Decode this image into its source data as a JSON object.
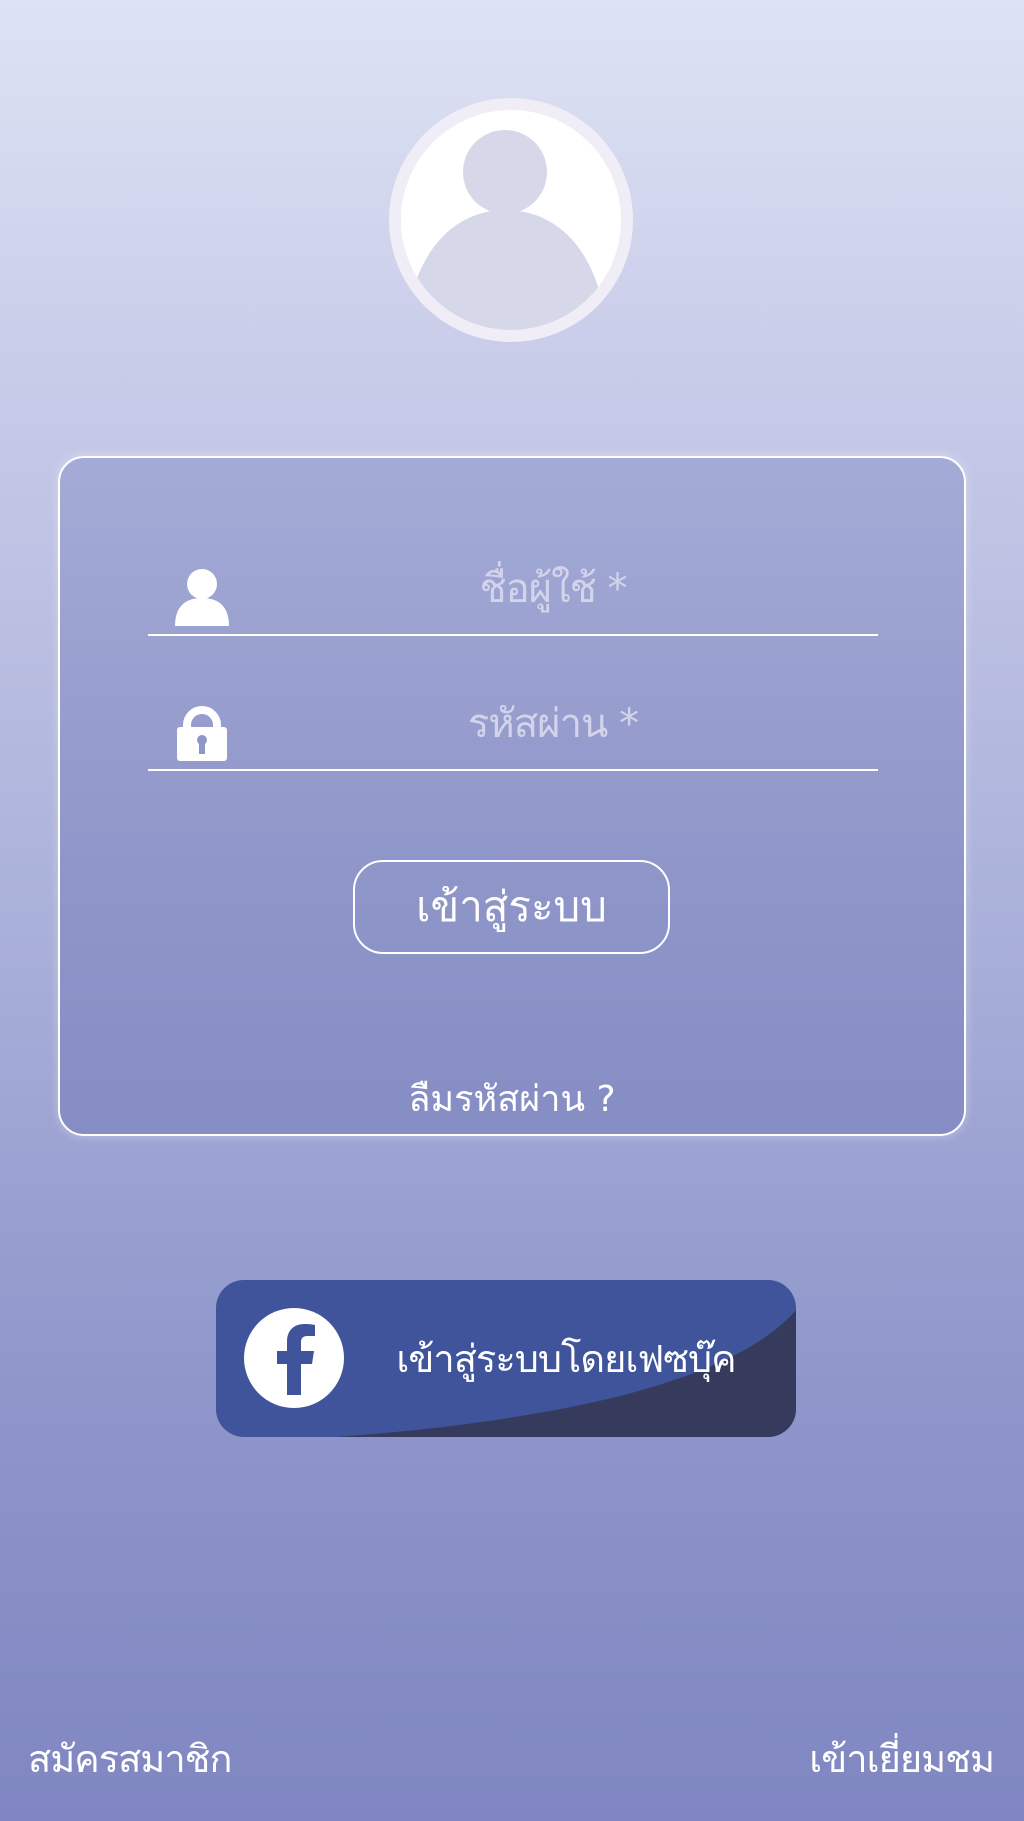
{
  "avatar": {
    "icon": "user-avatar-icon"
  },
  "login_form": {
    "username": {
      "placeholder": "ชื่อผู้ใช้ *",
      "icon": "user-icon"
    },
    "password": {
      "placeholder": "รหัสผ่าน *",
      "icon": "lock-icon"
    },
    "login_label": "เข้าสู่ระบบ",
    "forgot_label": "ลืมรหัสผ่าน ?"
  },
  "facebook": {
    "label": "เข้าสู่ระบบโดยเฟซบุ๊ค",
    "icon": "facebook-icon",
    "color": "#3f549b"
  },
  "footer": {
    "signup_label": "สมัครสมาชิก",
    "guest_label": "เข้าเยี่ยมชม"
  }
}
